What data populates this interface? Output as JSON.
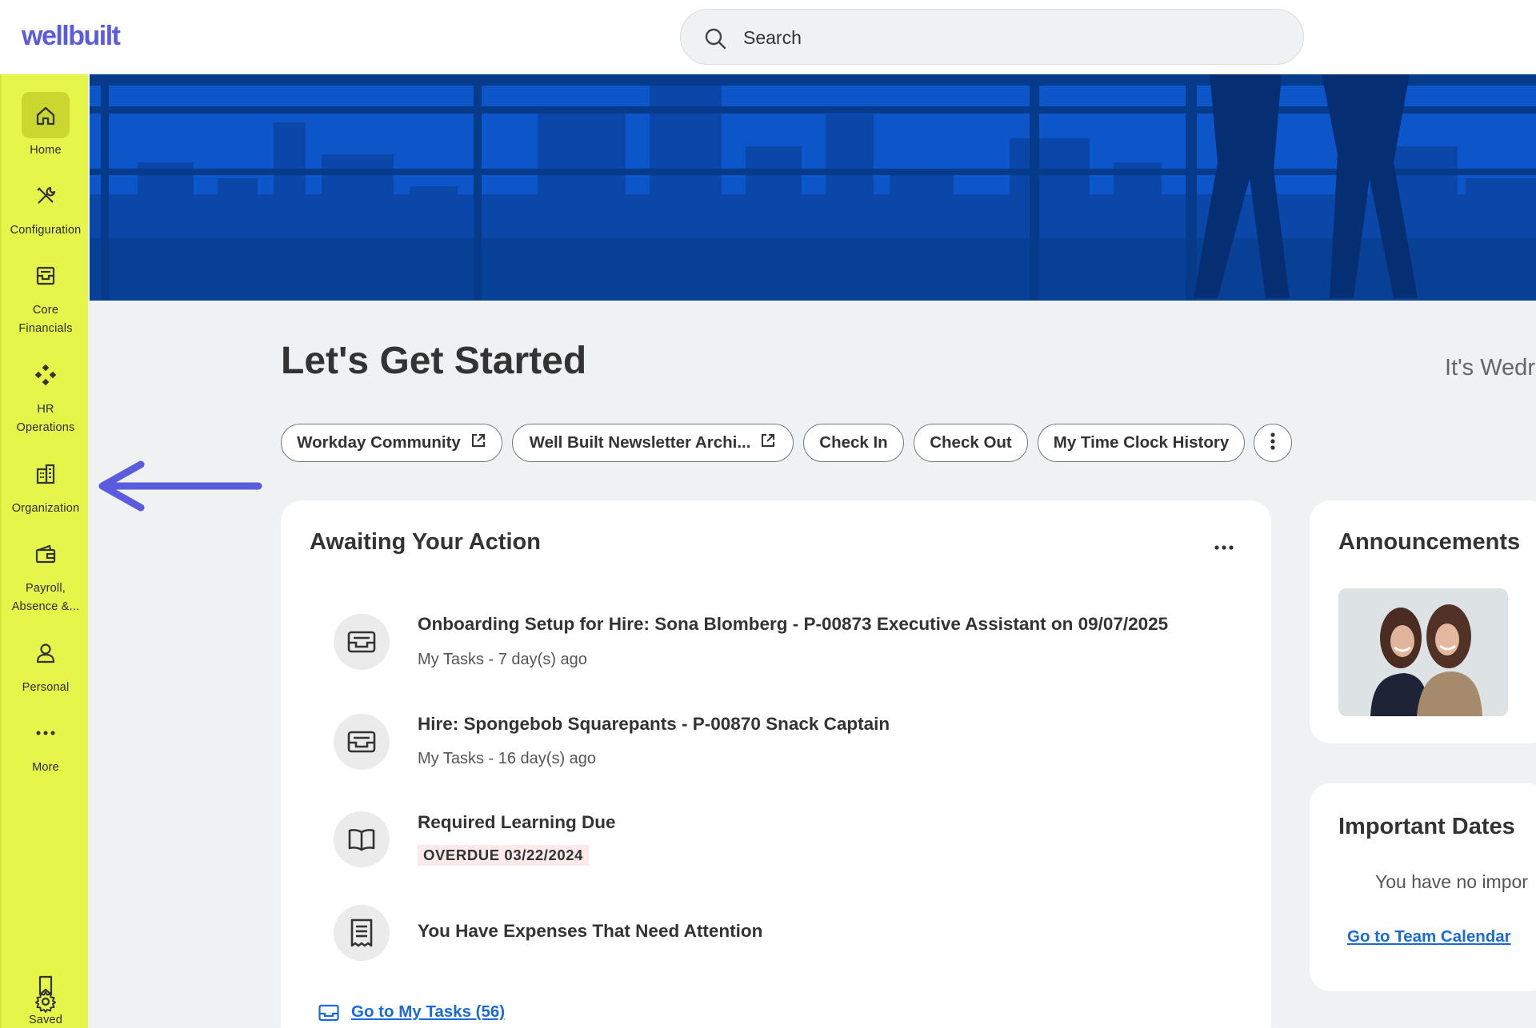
{
  "header": {
    "logo": "wellbuilt",
    "search_placeholder": "Search"
  },
  "sidebar": {
    "items": [
      {
        "label": "Home",
        "icon": "home-icon"
      },
      {
        "label": "Configuration",
        "icon": "tools-icon"
      },
      {
        "label": "Core\nFinancials",
        "icon": "inbox-tray-icon"
      },
      {
        "label": "HR\nOperations",
        "icon": "diamond-grid-icon"
      },
      {
        "label": "Organization",
        "icon": "building-icon"
      },
      {
        "label": "Payroll,\nAbsence &...",
        "icon": "wallet-icon"
      },
      {
        "label": "Personal",
        "icon": "person-icon"
      },
      {
        "label": "More",
        "icon": "more-dots-icon"
      }
    ],
    "saved_label": "Saved",
    "accent": "#e6f54a"
  },
  "main": {
    "title": "Let's Get Started",
    "date_text": "It's Wedr",
    "quick_links": [
      {
        "label": "Workday Community",
        "external": true
      },
      {
        "label": "Well Built Newsletter Archi...",
        "external": true
      },
      {
        "label": "Check In",
        "external": false
      },
      {
        "label": "Check Out",
        "external": false
      },
      {
        "label": "My Time Clock History",
        "external": false
      }
    ]
  },
  "awaiting": {
    "title": "Awaiting Your Action",
    "tasks": [
      {
        "title": "Onboarding Setup for Hire: Sona Blomberg - P-00873 Executive Assistant on 09/07/2025",
        "sub": "My Tasks - 7 day(s) ago",
        "icon": "inbox-tray-icon"
      },
      {
        "title": "Hire: Spongebob Squarepants - P-00870 Snack Captain",
        "sub": "My Tasks - 16 day(s) ago",
        "icon": "inbox-tray-icon"
      },
      {
        "title": "Required Learning Due",
        "badge": "OVERDUE 03/22/2024",
        "icon": "book-icon"
      },
      {
        "title": "You Have Expenses That Need Attention",
        "icon": "receipt-icon"
      }
    ],
    "footer_link": "Go to My Tasks (56)"
  },
  "announcements": {
    "title": "Announcements"
  },
  "important_dates": {
    "title": "Important Dates",
    "empty_text": "You have no impor",
    "link": "Go to Team Calendar"
  },
  "colors": {
    "brand": "#5b5be0",
    "hero_blue": "#0d56c9",
    "link": "#1a6bd6",
    "arrow": "#5b5be0"
  }
}
